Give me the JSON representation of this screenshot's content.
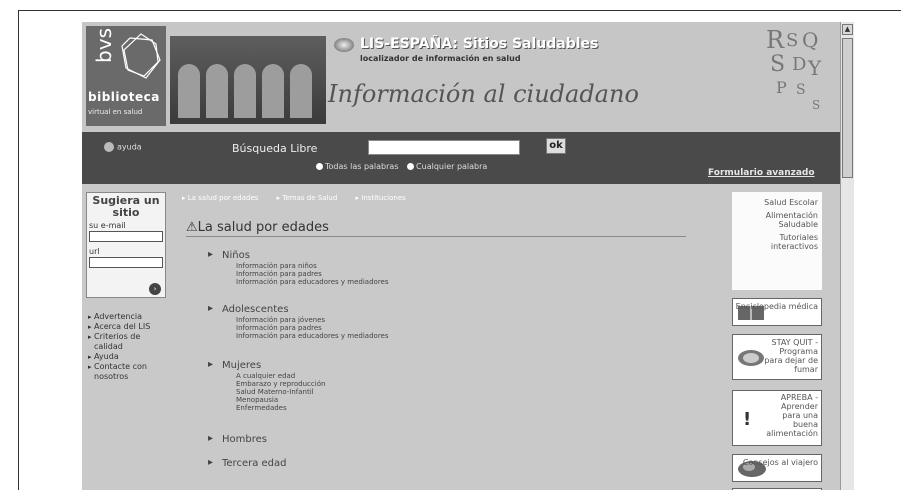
{
  "header": {
    "logo_word": "bvs",
    "logo_name": "biblioteca",
    "logo_sub": "virtual en salud",
    "lis_title": "LIS-ESPAÑA: Sitios Saludables",
    "lis_subtitle": "localizador de información en salud",
    "main_title": "Información al ciudadano"
  },
  "search": {
    "help_label": "ayuda",
    "label": "Búsqueda Libre",
    "input_value": "",
    "ok_label": "ok",
    "radio_all": "Todas las palabras",
    "radio_any": "Cualquier palabra",
    "advanced_label": "Formulario avanzado"
  },
  "suggest": {
    "title": "Sugiera un sitio",
    "email_label": "su e-mail",
    "url_label": "url",
    "go_label": "›"
  },
  "left_links": [
    "Advertencia",
    "Acerca del LIS",
    "Criterios de calidad",
    "Ayuda",
    "Contacte con nosotros"
  ],
  "breadcrumb": [
    "La salud por edades",
    "Temas de Salud",
    "Instituciones"
  ],
  "main": {
    "section_title": "La salud por edades",
    "groups": [
      {
        "title": "Niños",
        "items": [
          "Información para niños",
          "Información para padres",
          "Información para educadores y mediadores"
        ]
      },
      {
        "title": "Adolescentes",
        "items": [
          "Información para jóvenes",
          "Información para padres",
          "Información para educadores y mediadores"
        ]
      },
      {
        "title": "Mujeres",
        "items": [
          "A cualquier edad",
          "Embarazo y reproducción",
          "Salud Materno-Infantil",
          "Menopausia",
          "Enfermedades"
        ]
      },
      {
        "title": "Hombres",
        "items": []
      },
      {
        "title": "Tercera edad",
        "items": []
      }
    ]
  },
  "right": {
    "top_items": [
      "Salud Escolar",
      "Alimentación Saludable",
      "Tutoriales interactivos"
    ],
    "promos": [
      {
        "text": "Enciclopedia médica"
      },
      {
        "text": "STAY QUIT - Programa para dejar de fumar"
      },
      {
        "text": "APREBA - Aprender para una buena alimentación"
      },
      {
        "text": "Consejos al viajero"
      }
    ]
  }
}
